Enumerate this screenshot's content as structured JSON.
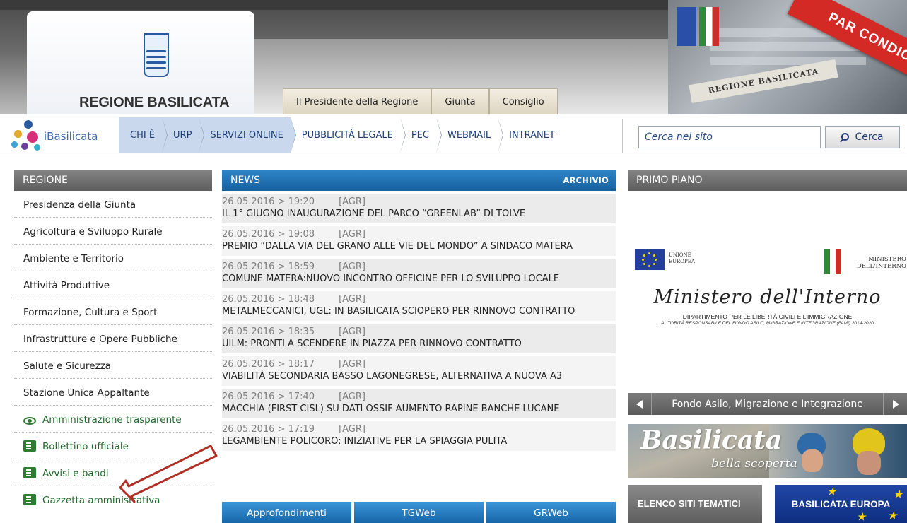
{
  "header": {
    "logo_text": "REGIONE BASILICATA",
    "top_tabs": [
      "Il Presidente della Regione",
      "Giunta",
      "Consiglio"
    ],
    "banner": "PAR CONDICIO",
    "building_sign": "REGIONE BASILICATA"
  },
  "nav": {
    "brand": "iBasilicata",
    "items": [
      "CHI È",
      "URP",
      "SERVIZI ONLINE",
      "PUBBLICITÀ LEGALE",
      "PEC",
      "WEBMAIL",
      "INTRANET"
    ],
    "search_placeholder": "Cerca nel sito",
    "search_button": "Cerca"
  },
  "left": {
    "header": "REGIONE",
    "items": [
      "Presidenza della Giunta",
      "Agricoltura e Sviluppo Rurale",
      "Ambiente e Territorio",
      "Attività Produttive",
      "Formazione, Cultura e Sport",
      "Infrastrutture e Opere Pubbliche",
      "Salute e Sicurezza",
      "Stazione Unica Appaltante"
    ],
    "green_items": [
      {
        "label": "Amministrazione trasparente",
        "icon": "eye-icon"
      },
      {
        "label": "Bollettino ufficiale",
        "icon": "bulletin-icon"
      },
      {
        "label": "Avvisi e bandi",
        "icon": "notice-icon"
      },
      {
        "label": "Gazzetta amministrativa",
        "icon": "gazette-icon"
      }
    ]
  },
  "news": {
    "header": "NEWS",
    "archive": "ARCHIVIO",
    "items": [
      {
        "date": "26.05.2016 > 19:20",
        "tag": "[AGR]",
        "title": "IL 1° GIUGNO INAUGURAZIONE DEL PARCO “GREENLAB” DI TOLVE"
      },
      {
        "date": "26.05.2016 > 19:08",
        "tag": "[AGR]",
        "title": "PREMIO “DALLA VIA DEL GRANO ALLE VIE DEL MONDO” A SINDACO MATERA"
      },
      {
        "date": "26.05.2016 > 18:59",
        "tag": "[AGR]",
        "title": "COMUNE MATERA:NUOVO INCONTRO OFFICINE PER LO SVILUPPO LOCALE"
      },
      {
        "date": "26.05.2016 > 18:48",
        "tag": "[AGR]",
        "title": "METALMECCANICI, UGL: IN BASILICATA SCIOPERO PER RINNOVO CONTRATTO"
      },
      {
        "date": "26.05.2016 > 18:35",
        "tag": "[AGR]",
        "title": "UILM: PRONTI A SCENDERE IN PIAZZA PER RINNOVO CONTRATTO"
      },
      {
        "date": "26.05.2016 > 18:17",
        "tag": "[AGR]",
        "title": "VIABILITÀ SECONDARIA BASSO LAGONEGRESE, ALTERNATIVA A NUOVA A3"
      },
      {
        "date": "26.05.2016 > 17:40",
        "tag": "[AGR]",
        "title": "MACCHIA (FIRST CISL) SU DATI OSSIF AUMENTO RAPINE BANCHE LUCANE"
      },
      {
        "date": "26.05.2016 > 17:19",
        "tag": "[AGR]",
        "title": "LEGAMBIENTE POLICORO: INIZIATIVE PER LA SPIAGGIA PULITA"
      }
    ],
    "tabs": [
      "Approfondimenti",
      "TGWeb",
      "GRWeb"
    ]
  },
  "primo_piano": {
    "header": "PRIMO PIANO",
    "eu_text": "UNIONE EUROPEA",
    "ministry_text": "MINISTERO DELL'INTERNO",
    "ministry_script": "Ministero dell'Interno",
    "department": "DIPARTIMENTO PER LE LIBERTÀ CIVILI E L'IMMIGRAZIONE",
    "authority": "AUTORITÀ RESPONSABILE DEL FONDO ASILO, MIGRAZIONE E INTEGRAZIONE (FAMI) 2014-2020",
    "slider_caption": "Fondo Asilo, Migrazione e Integrazione",
    "bella_title": "Basilicata",
    "bella_sub": "bella scoperta",
    "elenco": "ELENCO SITI TEMATICI",
    "europa": "BASILICATA EUROPA"
  },
  "colors": {
    "nav_blue": "#c9d8ec",
    "news_blue": "#1f74b8",
    "green": "#1f6a2a",
    "arrow": "#b02f24",
    "banner_red": "#d42a26"
  }
}
